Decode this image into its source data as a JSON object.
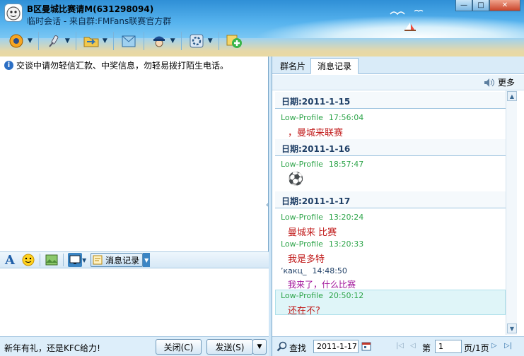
{
  "window": {
    "title": "B区曼城比赛请M(631298094)",
    "subtitle": "临时会话 - 来自群:FMFans联赛官方群",
    "controls": {
      "minimize": "—",
      "maximize": "□",
      "close": "✕"
    }
  },
  "toolbar": {
    "items": [
      {
        "name": "video-call",
        "icon": "camera-icon"
      },
      {
        "name": "voice-call",
        "icon": "microphone-icon"
      },
      {
        "name": "send-file",
        "icon": "folder-icon"
      },
      {
        "name": "send-mail",
        "icon": "envelope-icon"
      },
      {
        "name": "app-menu",
        "icon": "captain-icon"
      },
      {
        "name": "settings",
        "icon": "gear-icon"
      },
      {
        "name": "add-app",
        "icon": "plus-icon"
      }
    ]
  },
  "left": {
    "notice": "交谈中请勿轻信汇款、中奖信息，勿轻易拨打陌生电话。",
    "format_bar": {
      "font_icon": "A",
      "message_record_label": "消息记录"
    },
    "promo": "新年有礼，还是KFC给力!",
    "close_label": "关闭(C)",
    "send_label": "发送(S)"
  },
  "right": {
    "tabs": [
      "群名片",
      "消息记录"
    ],
    "more_label": "更多",
    "dates": [
      "日期:2011-1-15",
      "日期:2011-1-16",
      "日期:2011-1-17"
    ],
    "messages": [
      {
        "sender": "Low-Profile",
        "time": "17:56:04",
        "text": "，曼城来联赛"
      },
      {
        "sender": "Low-Profile",
        "time": "18:57:47",
        "text": "⚽"
      },
      {
        "sender": "Low-Profile",
        "time": "13:20:24",
        "text": "曼城来  比赛"
      },
      {
        "sender": "Low-Profile",
        "time": "13:20:33",
        "text": "我是多特"
      },
      {
        "sender": "’какц_",
        "time": "14:48:50",
        "text": "我来了，什么比赛"
      },
      {
        "sender": "Low-Profile",
        "time": "20:50:12",
        "text": "还在不?"
      }
    ],
    "search": {
      "label": "查找",
      "date": "2011-1-17",
      "page_prefix": "第",
      "page_value": "1",
      "page_suffix": "页/1页"
    }
  },
  "colors": {
    "sender": "#2ea54a",
    "message": "#c11b1b",
    "other_message": "#a0129a",
    "other_sender": "#1f3f66"
  }
}
